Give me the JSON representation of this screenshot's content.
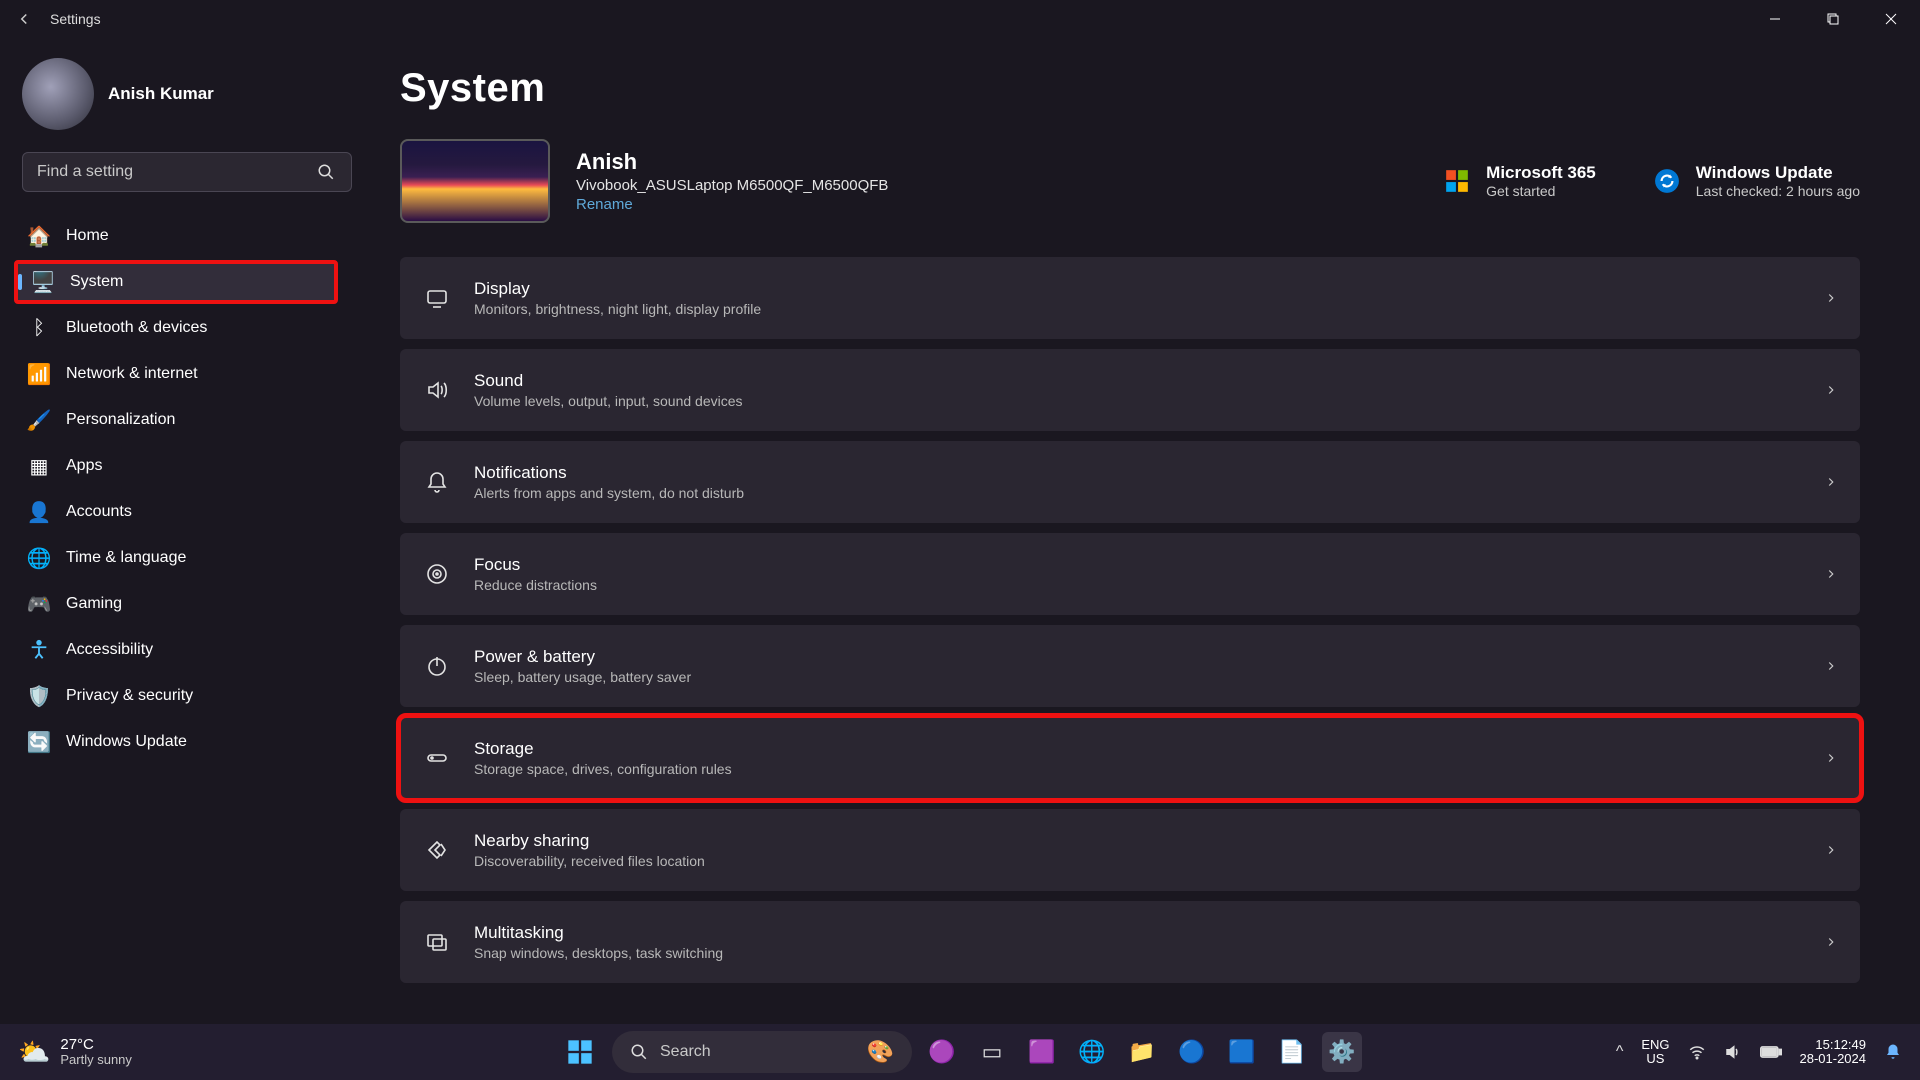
{
  "window": {
    "title": "Settings"
  },
  "user": {
    "name": "Anish Kumar"
  },
  "search": {
    "placeholder": "Find a setting"
  },
  "nav": [
    {
      "icon": "🏠",
      "label": "Home",
      "selected": false
    },
    {
      "icon": "🖥️",
      "label": "System",
      "selected": true,
      "highlighted": true
    },
    {
      "icon": "ᛒ",
      "label": "Bluetooth & devices",
      "selected": false
    },
    {
      "icon": "📶",
      "label": "Network & internet",
      "selected": false
    },
    {
      "icon": "🖌️",
      "label": "Personalization",
      "selected": false
    },
    {
      "icon": "▦",
      "label": "Apps",
      "selected": false
    },
    {
      "icon": "👤",
      "label": "Accounts",
      "selected": false
    },
    {
      "icon": "🌐",
      "label": "Time & language",
      "selected": false
    },
    {
      "icon": "🎮",
      "label": "Gaming",
      "selected": false
    },
    {
      "icon": "✖",
      "label": "Accessibility",
      "selected": false,
      "accessibility": true
    },
    {
      "icon": "🛡️",
      "label": "Privacy & security",
      "selected": false
    },
    {
      "icon": "🔄",
      "label": "Windows Update",
      "selected": false
    }
  ],
  "page": {
    "title": "System"
  },
  "device": {
    "name": "Anish",
    "model": "Vivobook_ASUSLaptop M6500QF_M6500QFB",
    "rename": "Rename"
  },
  "promos": [
    {
      "title": "Microsoft 365",
      "sub": "Get started",
      "icon": "ms365"
    },
    {
      "title": "Windows Update",
      "sub": "Last checked: 2 hours ago",
      "icon": "update"
    }
  ],
  "cards": [
    {
      "id": "display",
      "title": "Display",
      "sub": "Monitors, brightness, night light, display profile"
    },
    {
      "id": "sound",
      "title": "Sound",
      "sub": "Volume levels, output, input, sound devices"
    },
    {
      "id": "notifications",
      "title": "Notifications",
      "sub": "Alerts from apps and system, do not disturb"
    },
    {
      "id": "focus",
      "title": "Focus",
      "sub": "Reduce distractions"
    },
    {
      "id": "power",
      "title": "Power & battery",
      "sub": "Sleep, battery usage, battery saver"
    },
    {
      "id": "storage",
      "title": "Storage",
      "sub": "Storage space, drives, configuration rules",
      "highlighted": true
    },
    {
      "id": "nearby",
      "title": "Nearby sharing",
      "sub": "Discoverability, received files location"
    },
    {
      "id": "multitasking",
      "title": "Multitasking",
      "sub": "Snap windows, desktops, task switching"
    }
  ],
  "taskbar": {
    "weather": {
      "temp": "27°C",
      "desc": "Partly sunny"
    },
    "search": "Search",
    "lang": {
      "top": "ENG",
      "bottom": "US"
    },
    "clock": {
      "time": "15:12:49",
      "date": "28-01-2024"
    }
  }
}
